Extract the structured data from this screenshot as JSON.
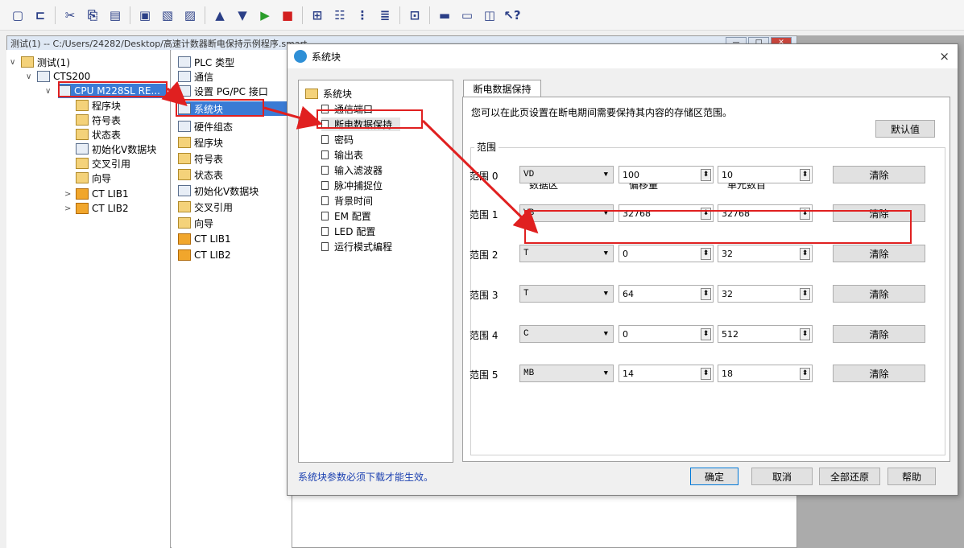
{
  "toolbar": {
    "icons": [
      "new-icon",
      "open-icon",
      "cut-icon",
      "copy-icon",
      "paste-icon",
      "import-icon",
      "export-icon",
      "compare-icon",
      "upload-icon",
      "download-icon",
      "run-icon",
      "stop-icon",
      "compile-icon",
      "tree-icon",
      "grid-icon",
      "table-icon",
      "library-icon",
      "monitor-icon",
      "window-icon",
      "layout-icon",
      "help-icon"
    ]
  },
  "window": {
    "title": "测试(1) -- C:/Users/24282/Desktop/高速计数器断电保持示例程序.smart"
  },
  "tree_left": [
    {
      "label": "测试(1)",
      "icon": "project-icon",
      "twist": "∨"
    },
    {
      "label": "CTS200",
      "icon": "plc-icon",
      "twist": "∨"
    },
    {
      "label": "CPU M228SL RE...",
      "icon": "cpu-icon",
      "twist": "∨",
      "selected": true
    },
    {
      "label": "程序块",
      "icon": "folder-icon"
    },
    {
      "label": "符号表",
      "icon": "folder-icon"
    },
    {
      "label": "状态表",
      "icon": "folder-icon"
    },
    {
      "label": "初始化V数据块",
      "icon": "data-icon"
    },
    {
      "label": "交叉引用",
      "icon": "folder-icon"
    },
    {
      "label": "向导",
      "icon": "folder-icon"
    },
    {
      "label": "CT LIB1",
      "icon": "lib-icon",
      "twist": ">"
    },
    {
      "label": "CT LIB2",
      "icon": "lib-icon",
      "twist": ">"
    }
  ],
  "tree_mid": [
    {
      "label": "PLC 类型"
    },
    {
      "label": "通信"
    },
    {
      "label": "设置 PG/PC 接口"
    },
    {
      "label": "系统块",
      "selected": true
    },
    {
      "label": "硬件组态"
    },
    {
      "label": "程序块"
    },
    {
      "label": "符号表"
    },
    {
      "label": "状态表"
    },
    {
      "label": "初始化V数据块"
    },
    {
      "label": "交叉引用"
    },
    {
      "label": "向导"
    },
    {
      "label": "CT LIB1"
    },
    {
      "label": "CT LIB2"
    }
  ],
  "dialog": {
    "title": "系统块",
    "close": "×",
    "nav_root": "系统块",
    "nav": [
      "通信端口",
      "断电数据保持",
      "密码",
      "输出表",
      "输入滤波器",
      "脉冲捕捉位",
      "背景时间",
      "EM 配置",
      "LED 配置",
      "运行模式编程"
    ],
    "nav_selected": 1,
    "footer_note": "系统块参数必须下载才能生效。",
    "tab": "断电数据保持",
    "description": "您可以在此页设置在断电期间需要保持其内容的存储区范围。",
    "default_btn": "默认值",
    "group_title": "范围",
    "col_area": "数据区",
    "col_offset": "偏移量",
    "col_count": "单元数目",
    "clear_label": "清除",
    "rows": [
      {
        "label": "范围 0",
        "area": "VD",
        "offset": "100",
        "count": "10"
      },
      {
        "label": "范围 1",
        "area": "VB",
        "offset": "32768",
        "count": "32768"
      },
      {
        "label": "范围 2",
        "area": "T",
        "offset": "0",
        "count": "32"
      },
      {
        "label": "范围 3",
        "area": "T",
        "offset": "64",
        "count": "32"
      },
      {
        "label": "范围 4",
        "area": "C",
        "offset": "0",
        "count": "512"
      },
      {
        "label": "范围 5",
        "area": "MB",
        "offset": "14",
        "count": "18"
      }
    ],
    "ok": "确定",
    "cancel": "取消",
    "restore_all": "全部还原",
    "help": "帮助"
  }
}
